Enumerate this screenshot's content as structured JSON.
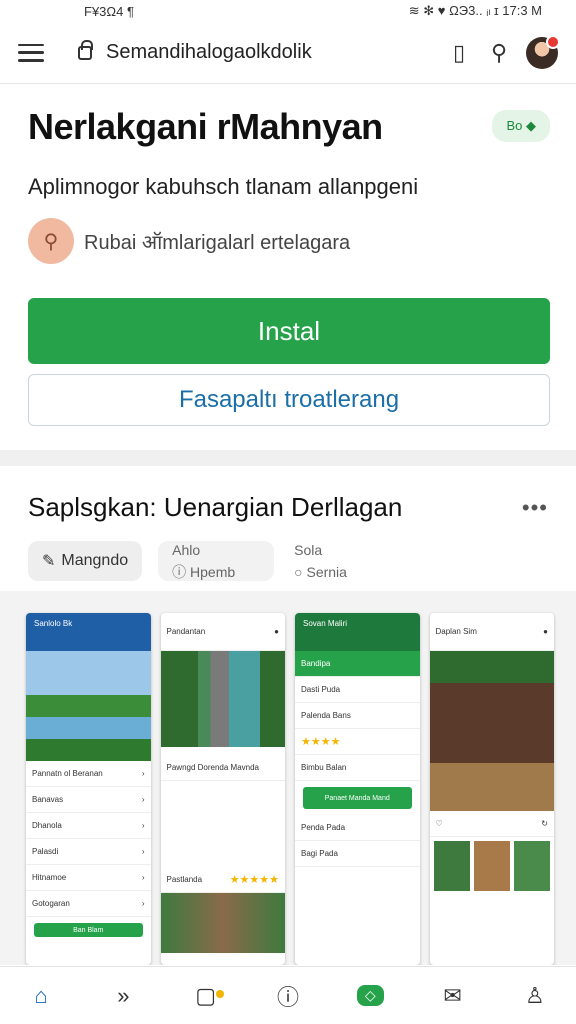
{
  "status_bar": {
    "left": "F¥3Ω4 ¶",
    "right": "≋ ✻ ♥ ΩЭ3.. ᵢₗ ɪ 17:3 M"
  },
  "browser": {
    "url": "Semandihalogaolkdolik"
  },
  "app": {
    "title": "Nerlakgani rMahnyan",
    "badge": "Bo ◆",
    "subtitle": "Aplimnogor kabuhsch tlanam allanpgeni",
    "developer": "Rubai ऑmlarigalarl ertelagara",
    "install_label": "Instal",
    "secondary_label": "Fasapaltı troatlerang"
  },
  "section": {
    "title": "Saplsgkan: Uenargian Derllagan",
    "chips": [
      {
        "label": "Mangndo",
        "icon": "pencil-icon"
      },
      {
        "label_top": "Ahlo",
        "label": "Hpemb",
        "icon": "info-icon"
      },
      {
        "label_top": "Sola",
        "label": "Sernia",
        "icon": "circle-icon"
      }
    ]
  },
  "screenshots": [
    {
      "header": "Sanlolo Bk",
      "rows": [
        "Pannatn ol Beranan",
        "Banavas",
        "Dhanola",
        "Palasdi",
        "Hitnamoe",
        "Gotogaran"
      ],
      "button": "Ban Blam"
    },
    {
      "header": "Pandantan",
      "caption": "Pawngd Dorenda Mavnda",
      "caption2": "Pastlanda",
      "stars": "★★★★★"
    },
    {
      "header": "Sovan Maliri",
      "rows": [
        "Bandipa",
        "Dasti Puda",
        "Palenda Bans",
        "Bimbu Balan",
        "Panaet Manda Mand",
        "Penda Pada",
        "Bagi Pada"
      ],
      "stars": "★★★★"
    },
    {
      "header": "Daplan Sim"
    }
  ],
  "bottom_nav": [
    "home-icon",
    "forward-icon",
    "chat-icon",
    "info-icon",
    "apps-icon",
    "mail-icon",
    "profile-icon"
  ],
  "colors": {
    "accent": "#25a24a",
    "link": "#1b6ea8",
    "header_blue": "#1e5fa6"
  }
}
